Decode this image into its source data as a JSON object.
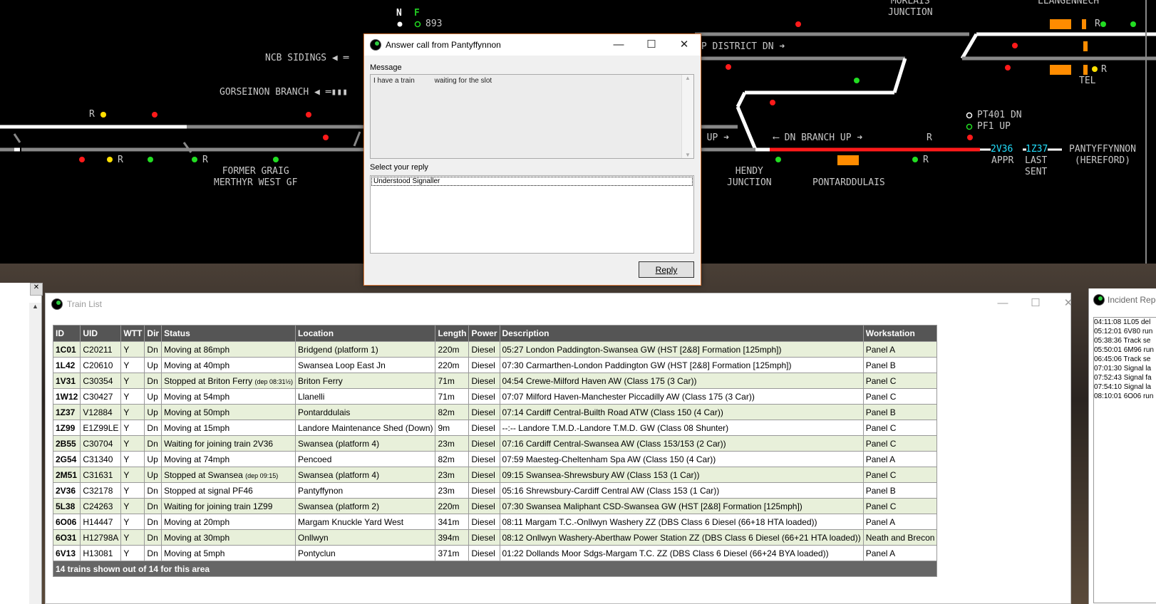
{
  "panel": {
    "labels": {
      "morlais": "MORLAIS\nJUNCTION",
      "llangennech": "LLANGENNECH",
      "n_flag": "N",
      "f_flag": "F",
      "berth_893": "893",
      "ncb_sidings": "NCB SIDINGS",
      "gorseinon_branch": "GORSEINON BRANCH",
      "former_graig": "FORMER GRAIG\nMERTHYR WEST GF",
      "up_district_dn": "UP DISTRICT DN",
      "up_arrow_label": "P UP",
      "dn_branch_up": "DN BRANCH UP",
      "hendy": "HENDY\nJUNCTION",
      "pontarddulais": "PONTARDDULAIS",
      "pt401": "PT401 DN",
      "pf1": "PF1 UP",
      "tel": "TEL",
      "appr_train": "2V36",
      "appr": "APPR",
      "last_train": "1Z37",
      "last_sent": "LAST\nSENT",
      "pantyffynnon": "PANTYFFYNNON\n(HEREFORD)",
      "r": "R"
    }
  },
  "dialog": {
    "title": "Answer call from Pantyffynnon",
    "message_label": "Message",
    "message_text": "I have a train          waiting for the slot",
    "reply_label": "Select your reply",
    "reply_options": [
      "Understood Signaller"
    ],
    "reply_button": "Reply"
  },
  "train_list": {
    "title": "Train List",
    "columns": [
      "ID",
      "UID",
      "WTT",
      "Dir",
      "Status",
      "Location",
      "Length",
      "Power",
      "Description",
      "Workstation"
    ],
    "rows": [
      {
        "id": "1C01",
        "uid": "C20211",
        "wtt": "Y",
        "dir": "Dn",
        "status": "Moving at 86mph",
        "status_note": "",
        "location": "Bridgend (platform 1)",
        "length": "220m",
        "power": "Diesel",
        "description": "05:27 London Paddington-Swansea GW (HST [2&8] Formation [125mph])",
        "workstation": "Panel A"
      },
      {
        "id": "1L42",
        "uid": "C20610",
        "wtt": "Y",
        "dir": "Up",
        "status": "Moving at 40mph",
        "status_note": "",
        "location": "Swansea Loop East Jn",
        "length": "220m",
        "power": "Diesel",
        "description": "07:30 Carmarthen-London Paddington GW (HST [2&8] Formation [125mph])",
        "workstation": "Panel B"
      },
      {
        "id": "1V31",
        "uid": "C30354",
        "wtt": "Y",
        "dir": "Dn",
        "status": "Stopped at Briton Ferry",
        "status_note": "(dep 08:31½)",
        "location": "Briton Ferry",
        "length": "71m",
        "power": "Diesel",
        "description": "04:54 Crewe-Milford Haven AW (Class 175 (3 Car))",
        "workstation": "Panel C"
      },
      {
        "id": "1W12",
        "uid": "C30427",
        "wtt": "Y",
        "dir": "Up",
        "status": "Moving at 54mph",
        "status_note": "",
        "location": "Llanelli",
        "length": "71m",
        "power": "Diesel",
        "description": "07:07 Milford Haven-Manchester Piccadilly AW (Class 175 (3 Car))",
        "workstation": "Panel C"
      },
      {
        "id": "1Z37",
        "uid": "V12884",
        "wtt": "Y",
        "dir": "Up",
        "status": "Moving at 50mph",
        "status_note": "",
        "location": "Pontarddulais",
        "length": "82m",
        "power": "Diesel",
        "description": "07:14 Cardiff Central-Builth Road ATW (Class 150 (4 Car))",
        "workstation": "Panel B"
      },
      {
        "id": "1Z99",
        "uid": "E1Z99LE",
        "wtt": "Y",
        "dir": "Dn",
        "status": "Moving at 15mph",
        "status_note": "",
        "location": "Landore Maintenance Shed (Down)",
        "length": "9m",
        "power": "Diesel",
        "description": "--:-- Landore T.M.D.-Landore T.M.D. GW (Class 08 Shunter)",
        "workstation": "Panel C"
      },
      {
        "id": "2B55",
        "uid": "C30704",
        "wtt": "Y",
        "dir": "Dn",
        "status": "Waiting for joining train 2V36",
        "status_note": "",
        "location": "Swansea (platform 4)",
        "length": "23m",
        "power": "Diesel",
        "description": "07:16 Cardiff Central-Swansea AW (Class 153/153 (2 Car))",
        "workstation": "Panel C"
      },
      {
        "id": "2G54",
        "uid": "C31340",
        "wtt": "Y",
        "dir": "Up",
        "status": "Moving at 74mph",
        "status_note": "",
        "location": "Pencoed",
        "length": "82m",
        "power": "Diesel",
        "description": "07:59 Maesteg-Cheltenham Spa AW (Class 150 (4 Car))",
        "workstation": "Panel A"
      },
      {
        "id": "2M51",
        "uid": "C31631",
        "wtt": "Y",
        "dir": "Up",
        "status": "Stopped at Swansea",
        "status_note": "(dep 09:15)",
        "location": "Swansea (platform 4)",
        "length": "23m",
        "power": "Diesel",
        "description": "09:15 Swansea-Shrewsbury AW (Class 153 (1 Car))",
        "workstation": "Panel C"
      },
      {
        "id": "2V36",
        "uid": "C32178",
        "wtt": "Y",
        "dir": "Dn",
        "status": "Stopped at signal PF46",
        "status_note": "",
        "location": "Pantyffynon",
        "length": "23m",
        "power": "Diesel",
        "description": "05:16 Shrewsbury-Cardiff Central AW (Class 153 (1 Car))",
        "workstation": "Panel B"
      },
      {
        "id": "5L38",
        "uid": "C24263",
        "wtt": "Y",
        "dir": "Dn",
        "status": "Waiting for joining train 1Z99",
        "status_note": "",
        "location": "Swansea (platform 2)",
        "length": "220m",
        "power": "Diesel",
        "description": "07:30 Swansea Maliphant CSD-Swansea GW (HST [2&8] Formation [125mph])",
        "workstation": "Panel C"
      },
      {
        "id": "6O06",
        "uid": "H14447",
        "wtt": "Y",
        "dir": "Dn",
        "status": "Moving at 20mph",
        "status_note": "",
        "location": "Margam Knuckle Yard West",
        "length": "341m",
        "power": "Diesel",
        "description": "08:11 Margam T.C.-Onllwyn Washery ZZ (DBS Class 6 Diesel (66+18 HTA loaded))",
        "workstation": "Panel A"
      },
      {
        "id": "6O31",
        "uid": "H12798A",
        "wtt": "Y",
        "dir": "Dn",
        "status": "Moving at 30mph",
        "status_note": "",
        "location": "Onllwyn",
        "length": "394m",
        "power": "Diesel",
        "description": "08:12 Onllwyn Washery-Aberthaw Power Station ZZ (DBS Class 6 Diesel (66+21 HTA loaded))",
        "workstation": "Neath and Brecon"
      },
      {
        "id": "6V13",
        "uid": "H13081",
        "wtt": "Y",
        "dir": "Dn",
        "status": "Moving at 5mph",
        "status_note": "",
        "location": "Pontyclun",
        "length": "371m",
        "power": "Diesel",
        "description": "01:22 Dollands Moor Sdgs-Margam T.C. ZZ (DBS Class 6 Diesel (66+24 BYA loaded))",
        "workstation": "Panel A"
      }
    ],
    "footer": "14 trains shown out of 14 for this area"
  },
  "incident": {
    "title": "Incident Repo",
    "entries": [
      "04:11:08 1L05 del",
      "05:12:01 6V80 run",
      "05:38:36 Track se",
      "05:50:01 6M96 run",
      "06:45:06 Track se",
      "07:01:30 Signal la",
      "07:52:43 Signal fa",
      "07:54:10 Signal la",
      "08:10:01 6O06 run"
    ]
  }
}
